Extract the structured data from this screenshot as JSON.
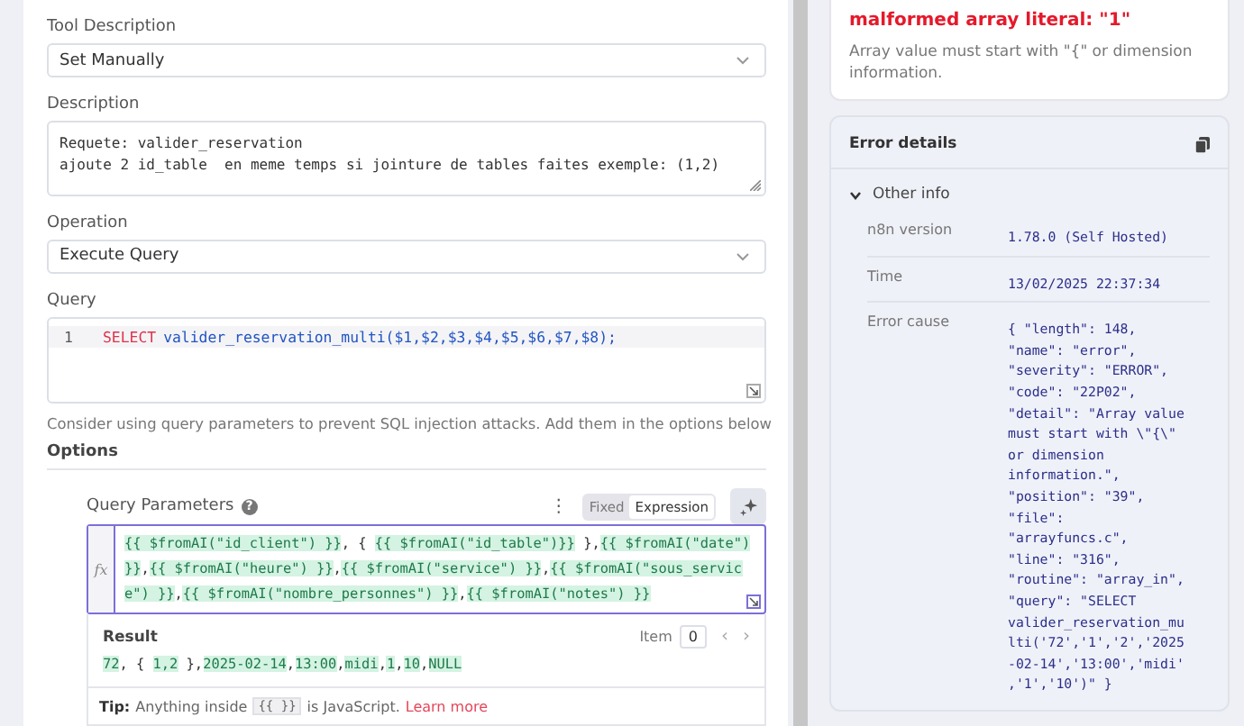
{
  "tool_description": {
    "label": "Tool Description",
    "value": "Set Manually"
  },
  "description": {
    "label": "Description",
    "lines": [
      "Requete: valider_reservation",
      "ajoute 2 id_table  en meme temps si jointure de tables faites exemple: (1,2)"
    ]
  },
  "operation": {
    "label": "Operation",
    "value": "Execute Query"
  },
  "query": {
    "label": "Query",
    "line_number": "1",
    "keyword": "SELECT",
    "code": "valider_reservation_multi($1,$2,$3,$4,$5,$6,$7,$8);",
    "hint": "Consider using query parameters to prevent SQL injection attacks. Add them in the options below"
  },
  "options": {
    "label": "Options"
  },
  "query_parameters": {
    "label": "Query Parameters",
    "help": "?",
    "menu": "⋮",
    "modes": [
      {
        "label": "Fixed",
        "selected": false
      },
      {
        "label": "Expression",
        "selected": true
      }
    ],
    "fx": "fx",
    "expression_lines": [
      [
        {
          "text": "{{ $fromAI(\"id_client\") }}",
          "kind": "expr"
        },
        {
          "text": ", { ",
          "kind": "plain"
        },
        {
          "text": "{{ $fromAI(\"id_table\")}}",
          "kind": "expr"
        },
        {
          "text": " },",
          "kind": "plain"
        },
        {
          "text": "{{ $fromAI(\"date\")",
          "kind": "expr"
        }
      ],
      [
        {
          "text": "}}",
          "kind": "expr"
        },
        {
          "text": ",",
          "kind": "plain"
        },
        {
          "text": "{{ $fromAI(\"heure\") }}",
          "kind": "expr"
        },
        {
          "text": ",",
          "kind": "plain"
        },
        {
          "text": "{{ $fromAI(\"service\") }}",
          "kind": "expr"
        },
        {
          "text": ",",
          "kind": "plain"
        },
        {
          "text": "{{ $fromAI(\"sous_servic",
          "kind": "expr"
        }
      ],
      [
        {
          "text": "e\") }}",
          "kind": "expr"
        },
        {
          "text": ",",
          "kind": "plain"
        },
        {
          "text": "{{ $fromAI(\"nombre_personnes\") }}",
          "kind": "expr"
        },
        {
          "text": ",",
          "kind": "plain"
        },
        {
          "text": "{{ $fromAI(\"notes\") }}",
          "kind": "expr"
        }
      ]
    ],
    "result": {
      "label": "Result",
      "item_label": "Item",
      "item_value": "0",
      "prev": "‹",
      "next": "›",
      "segments": [
        {
          "text": "72",
          "kind": "expr"
        },
        {
          "text": ", { ",
          "kind": "plain"
        },
        {
          "text": "1,2",
          "kind": "expr"
        },
        {
          "text": " },",
          "kind": "plain"
        },
        {
          "text": "2025-02-14",
          "kind": "expr"
        },
        {
          "text": ",",
          "kind": "plain"
        },
        {
          "text": "13:00",
          "kind": "expr"
        },
        {
          "text": ",",
          "kind": "plain"
        },
        {
          "text": "midi",
          "kind": "expr"
        },
        {
          "text": ",",
          "kind": "plain"
        },
        {
          "text": "1",
          "kind": "expr"
        },
        {
          "text": ",",
          "kind": "plain"
        },
        {
          "text": "10",
          "kind": "expr"
        },
        {
          "text": ",",
          "kind": "plain"
        },
        {
          "text": "NULL",
          "kind": "expr"
        }
      ]
    },
    "tip": {
      "label": "Tip:",
      "before": "Anything inside",
      "code": "{{ }}",
      "after": "is JavaScript.",
      "link": "Learn more"
    }
  },
  "error": {
    "title": "malformed array literal: \"1\"",
    "message": "Array value must start with \"{\" or dimension information."
  },
  "error_details": {
    "title": "Error details",
    "section": {
      "label": "Other info",
      "expanded": true
    },
    "rows": [
      {
        "key": "n8n version",
        "lines": [
          "1.78.0 (Self Hosted)"
        ]
      },
      {
        "key": "Time",
        "lines": [
          "13/02/2025 22:37:34"
        ]
      },
      {
        "key": "Error cause",
        "lines": [
          "{ \"length\": 148,",
          "\"name\": \"error\",",
          "\"severity\": \"ERROR\",",
          "\"code\": \"22P02\",",
          "\"detail\": \"Array value",
          "must start with \\\"{\\\"",
          "or dimension",
          "information.\",",
          "\"position\": \"39\",",
          "\"file\":",
          "\"arrayfuncs.c\",",
          "\"line\": \"316\",",
          "\"routine\": \"array_in\",",
          "\"query\": \"SELECT",
          "valider_reservation_mu",
          "lti('72','1','2','2025",
          "-02-14','13:00','midi'",
          ",'1','10')\" }"
        ]
      }
    ]
  }
}
